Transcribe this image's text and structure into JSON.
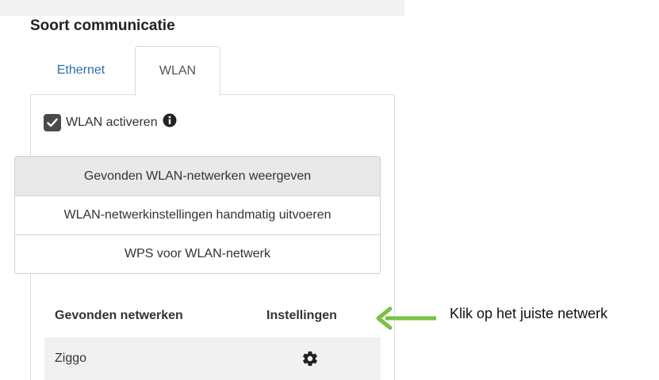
{
  "section": {
    "title": "Soort communicatie"
  },
  "tabs": [
    {
      "label": "Ethernet",
      "active": false
    },
    {
      "label": "WLAN",
      "active": true
    }
  ],
  "wlan": {
    "activate_label": "WLAN activeren",
    "activated": true,
    "info_icon": "info-circle-icon"
  },
  "options": [
    {
      "label": "Gevonden WLAN-netwerken weergeven",
      "selected": true
    },
    {
      "label": "WLAN-netwerkinstellingen handmatig uitvoeren",
      "selected": false
    },
    {
      "label": "WPS voor WLAN-netwerk",
      "selected": false
    }
  ],
  "networks": {
    "col_name": "Gevonden netwerken",
    "col_settings": "Instellingen",
    "rows": [
      {
        "name": "Ziggo",
        "settings_icon": "gear-icon"
      }
    ]
  },
  "annotation": {
    "text": "Klik op het juiste netwerk",
    "arrow_color": "#7ac142"
  }
}
